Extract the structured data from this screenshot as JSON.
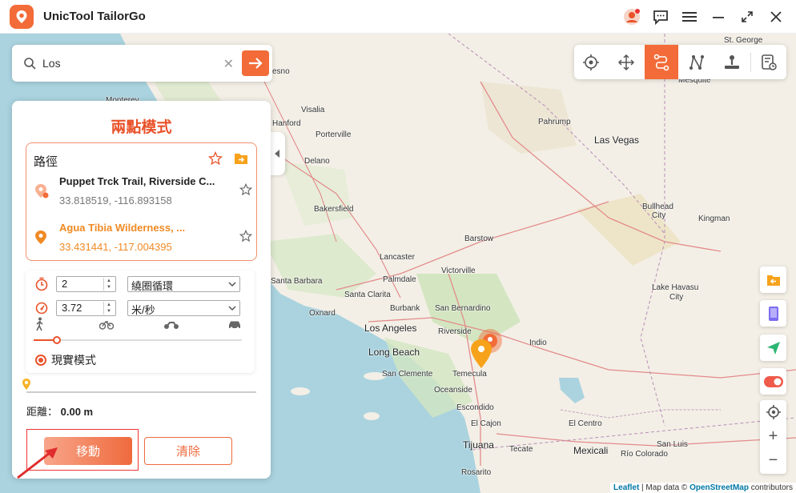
{
  "app": {
    "title": "UnicTool TailorGo"
  },
  "search": {
    "value": "Los"
  },
  "panel": {
    "title": "兩點模式",
    "route_title": "路徑",
    "point_a": {
      "name": "Puppet Trck Trail, Riverside C...",
      "coord": "33.818519, -116.893158"
    },
    "point_b": {
      "name": "Agua Tibia Wilderness, ...",
      "coord": "33.431441, -117.004395"
    },
    "times_value": "2",
    "loop_mode": "繞圈循環",
    "speed_value": "3.72",
    "speed_unit": "米/秒",
    "speed_slider": 0.11,
    "real_mode_label": "現實模式",
    "route_progress": 0.0,
    "distance_label": "距離：",
    "distance_value": "0.00 m",
    "move_label": "移動",
    "clear_label": "清除"
  },
  "map": {
    "labels": {
      "fresno": "esno",
      "monterey": "Monterey",
      "visalia": "Visalia",
      "hanford": "Hanford",
      "porterville": "Porterville",
      "delano": "Delano",
      "bakersfield": "Bakersfield",
      "lancaster": "Lancaster",
      "palmdale": "Palmdale",
      "victorville": "Victorville",
      "barstow": "Barstow",
      "santa_barbara": "Santa Barbara",
      "santa_clarita": "Santa Clarita",
      "oxnard": "Oxnard",
      "burbank": "Burbank",
      "san_bernardino": "San Bernardino",
      "los_angeles": "Los Angeles",
      "long_beach": "Long Beach",
      "riverside": "Riverside",
      "indio": "Indio",
      "san_clemente": "San Clemente",
      "temecula": "Temecula",
      "oceanside": "Oceanside",
      "escondido": "Escondido",
      "el_cajon": "El Cajon",
      "tijuana": "Tijuana",
      "tecate": "Tecate",
      "mexicali": "Mexicali",
      "el_centro": "El Centro",
      "san_luis": "San Luis",
      "rio_colorado": "Río Colorado",
      "rosarito": "Rosarito",
      "pahrump": "Pahrump",
      "las_vegas": "Las Vegas",
      "bullhead": "Bullhead",
      "bullhead_city": "City",
      "kingman": "Kingman",
      "lake_havasu": "Lake Havasu",
      "lake_havasu_city": "City",
      "mesquite": "Mesquite",
      "st_george": "St. George"
    }
  },
  "attribution": {
    "leaflet": "Leaflet",
    "sep": " | Map data © ",
    "osm": "OpenStreetMap",
    "contrib": " contributors"
  },
  "colors": {
    "accent": "#f26b38",
    "route_border": "#f0916c",
    "point_b": "#f08a24"
  }
}
